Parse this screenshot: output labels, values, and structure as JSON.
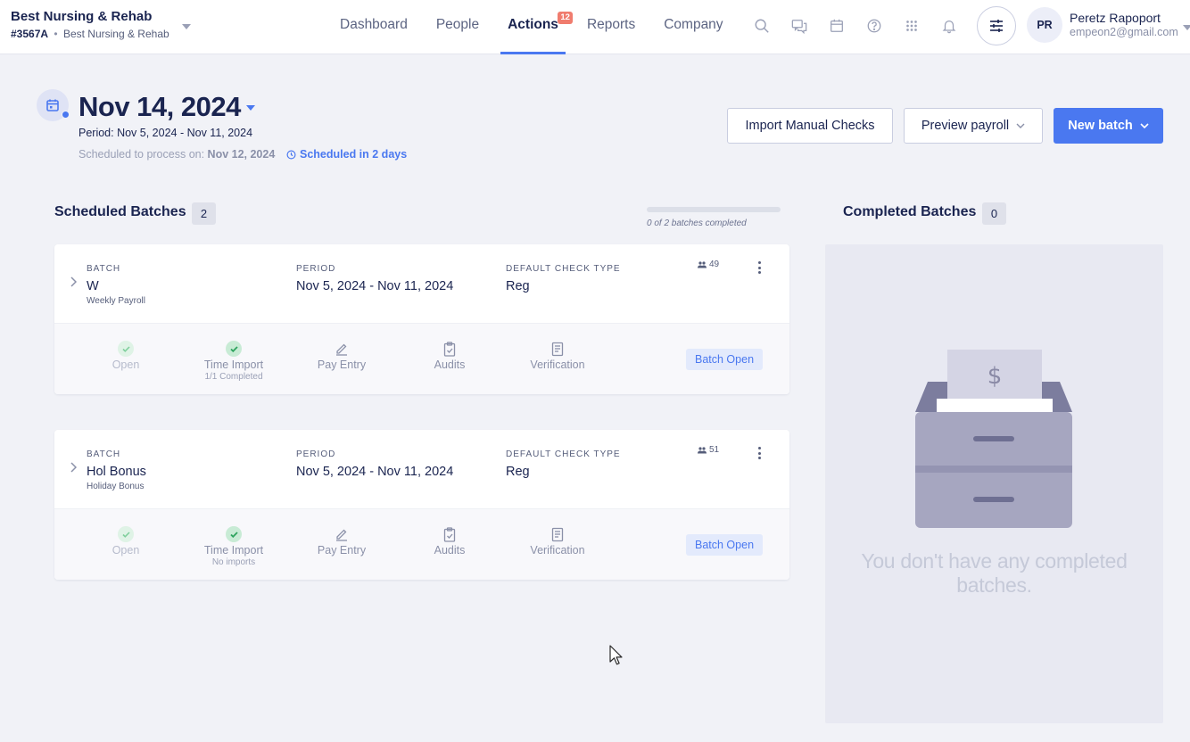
{
  "company": {
    "name": "Best Nursing & Rehab",
    "id": "#3567A",
    "separator": "•",
    "sub_name": "Best Nursing & Rehab"
  },
  "nav": {
    "items": [
      {
        "label": "Dashboard"
      },
      {
        "label": "People"
      },
      {
        "label": "Actions",
        "badge": "12",
        "active": true
      },
      {
        "label": "Reports"
      },
      {
        "label": "Company"
      }
    ]
  },
  "toolbar_icons": [
    "search-icon",
    "chat-icon",
    "calendar-icon",
    "help-icon",
    "apps-grid-icon",
    "bell-icon"
  ],
  "user": {
    "initials": "PR",
    "name": "Peretz Rapoport",
    "email": "empeon2@gmail.com"
  },
  "pay": {
    "date": "Nov 14, 2024",
    "period": "Period: Nov 5, 2024 - Nov 11, 2024",
    "scheduled_prefix": "Scheduled to process on: ",
    "scheduled_date": "Nov 12, 2024",
    "scheduled_tag": "Scheduled in 2 days"
  },
  "actions": {
    "import_manual_checks": "Import Manual Checks",
    "preview_payroll": "Preview payroll",
    "new_batch": "New batch"
  },
  "scheduled": {
    "title": "Scheduled Batches",
    "count": "2",
    "progress_text": "0 of 2 batches completed",
    "progress_fraction": 0,
    "labels": {
      "batch": "BATCH",
      "period": "PERIOD",
      "check_type": "DEFAULT CHECK TYPE"
    },
    "batches": [
      {
        "name": "W",
        "desc": "Weekly Payroll",
        "period": "Nov 5, 2024 - Nov 11, 2024",
        "check_type": "Reg",
        "employees": "49",
        "steps": [
          {
            "label": "Open",
            "sub": ""
          },
          {
            "label": "Time Import",
            "sub": "1/1 Completed"
          },
          {
            "label": "Pay Entry",
            "sub": ""
          },
          {
            "label": "Audits",
            "sub": ""
          },
          {
            "label": "Verification",
            "sub": ""
          }
        ],
        "status": "Batch Open"
      },
      {
        "name": "Hol Bonus",
        "desc": "Holiday Bonus",
        "period": "Nov 5, 2024 - Nov 11, 2024",
        "check_type": "Reg",
        "employees": "51",
        "steps": [
          {
            "label": "Open",
            "sub": ""
          },
          {
            "label": "Time Import",
            "sub": "No imports"
          },
          {
            "label": "Pay Entry",
            "sub": ""
          },
          {
            "label": "Audits",
            "sub": ""
          },
          {
            "label": "Verification",
            "sub": ""
          }
        ],
        "status": "Batch Open"
      }
    ]
  },
  "completed": {
    "title": "Completed Batches",
    "count": "0",
    "empty_message": "You don't have any completed batches.",
    "illustration_symbol": "$"
  },
  "colors": {
    "accent": "#4a78f0",
    "badge": "#f07c6e",
    "navy": "#1a2450",
    "success": "#2fa45f"
  }
}
